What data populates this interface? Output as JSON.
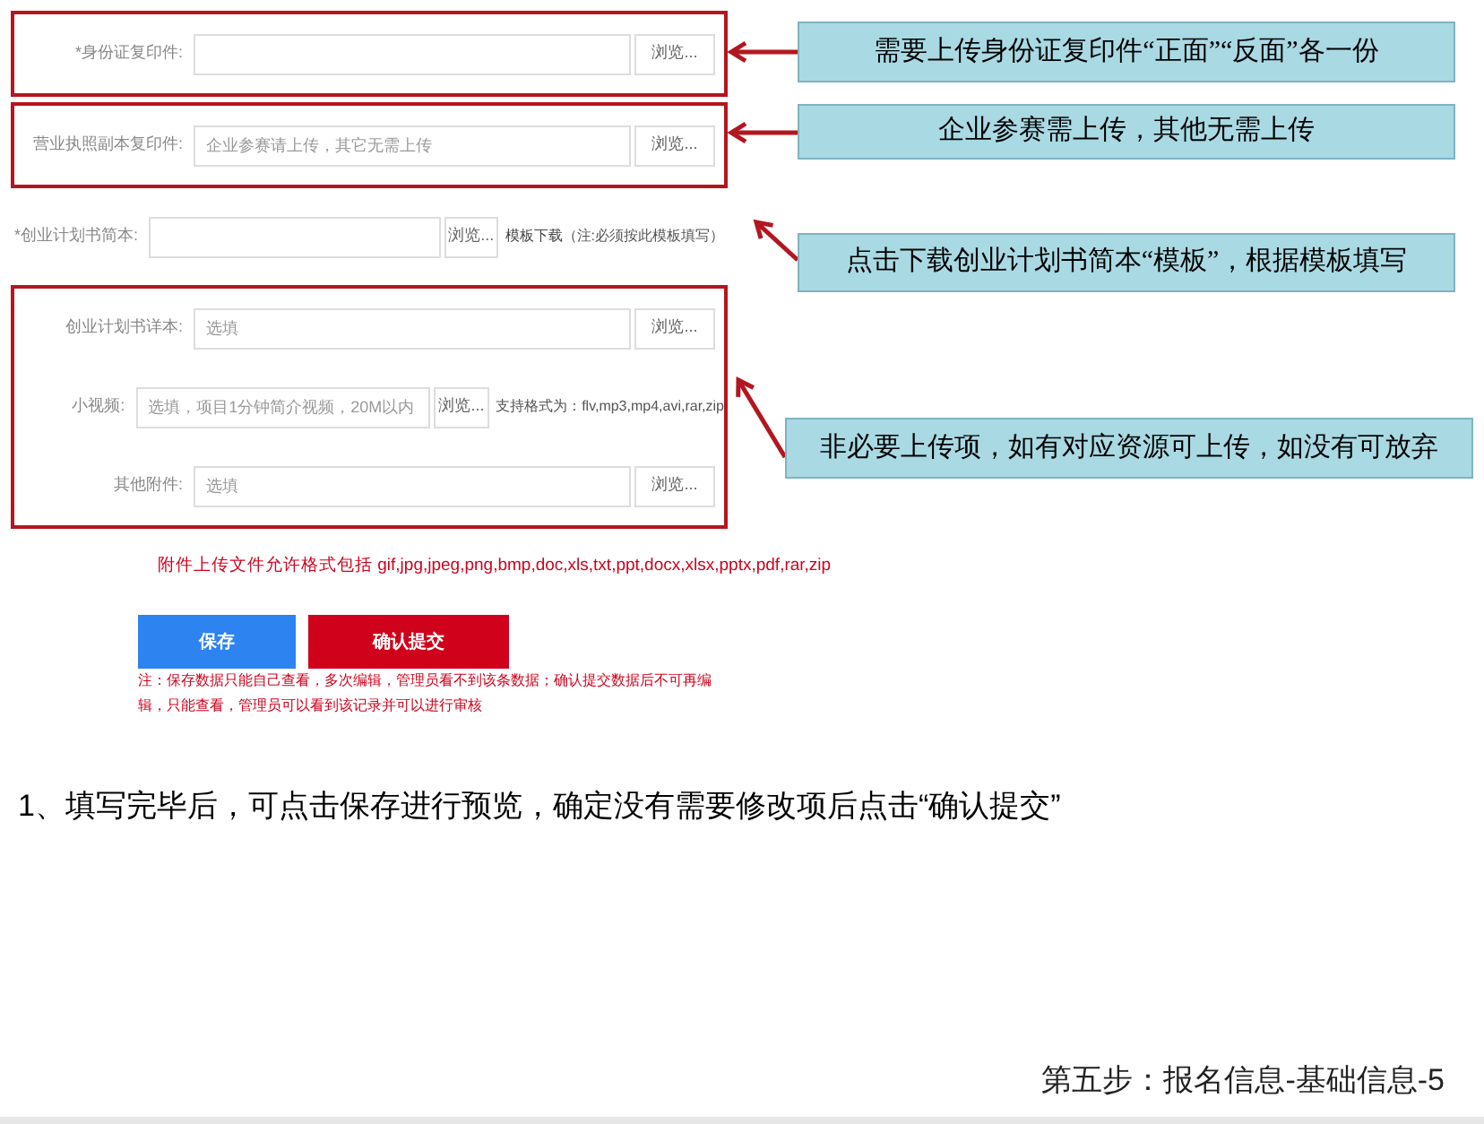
{
  "groups": [
    {
      "outlined": true,
      "rows": [
        {
          "label": "*身份证复印件:",
          "placeholder": "",
          "button": "浏览..."
        }
      ]
    },
    {
      "outlined": true,
      "rows": [
        {
          "label": "营业执照副本复印件:",
          "placeholder": "企业参赛请上传，其它无需上传",
          "button": "浏览..."
        }
      ]
    },
    {
      "outlined": false,
      "rows": [
        {
          "label": "*创业计划书简本:",
          "placeholder": "",
          "button": "浏览...",
          "link": "模板下载",
          "note": "（注:必须按此模板填写）"
        }
      ]
    },
    {
      "outlined": true,
      "rows": [
        {
          "label": "创业计划书详本:",
          "placeholder": "选填",
          "button": "浏览..."
        },
        {
          "label": "小视频:",
          "placeholder": "选填，项目1分钟简介视频，20M以内",
          "button": "浏览...",
          "note": "支持格式为：flv,mp3,mp4,avi,rar,zip"
        },
        {
          "label": "其他附件:",
          "placeholder": "选填",
          "button": "浏览..."
        }
      ]
    }
  ],
  "allowed_formats": "附件上传文件允许格式包括 gif,jpg,jpeg,png,bmp,doc,xls,txt,ppt,docx,xlsx,pptx,pdf,rar,zip",
  "buttons": [
    {
      "label": "保存",
      "kind": "primary"
    },
    {
      "label": "确认提交",
      "kind": "danger"
    }
  ],
  "form_note": "注：保存数据只能自己查看，多次编辑，管理员看不到该条数据；确认提交数据后不可再编辑，只能查看，管理员可以看到该记录并可以进行审核",
  "callouts": [
    {
      "text": "需要上传身份证复印件“正面”“反面”各一份"
    },
    {
      "text": "企业参赛需上传，其他无需上传"
    },
    {
      "text": "点击下载创业计划书简本“模板”，根据模板填写"
    },
    {
      "text": "非必要上传项，如有对应资源可上传，如没有可放弃"
    }
  ],
  "instruction": "1、填写完毕后，可点击保存进行预览，确定没有需要修改项后点击“确认提交”",
  "footer": "第五步：报名信息-基础信息-5"
}
